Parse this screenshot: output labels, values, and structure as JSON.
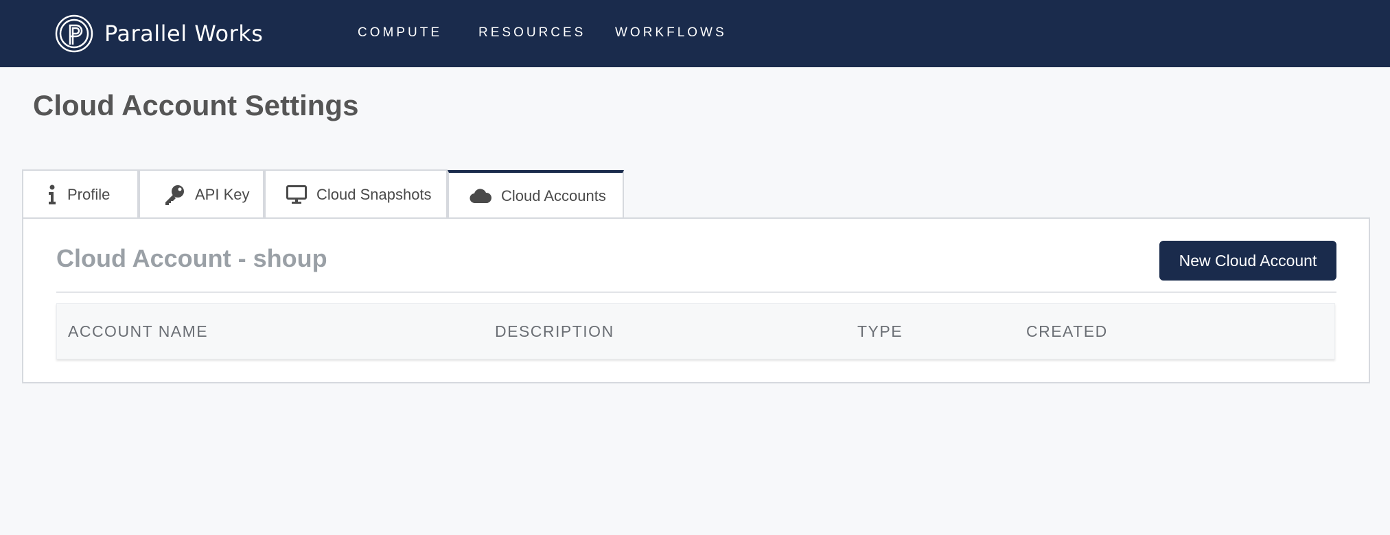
{
  "app": {
    "logo_text": "Parallel Works"
  },
  "nav": {
    "items": [
      {
        "label": "COMPUTE"
      },
      {
        "label": "RESOURCES"
      },
      {
        "label": "WORKFLOWS"
      }
    ]
  },
  "page": {
    "title": "Cloud Account Settings"
  },
  "tabs": [
    {
      "label": "Profile",
      "icon": "info-icon"
    },
    {
      "label": "API Key",
      "icon": "key-icon"
    },
    {
      "label": "Cloud Snapshots",
      "icon": "monitor-icon"
    },
    {
      "label": "Cloud Accounts",
      "icon": "cloud-icon",
      "active": true
    }
  ],
  "panel": {
    "title": "Cloud Account - shoup",
    "new_button_label": "New Cloud Account"
  },
  "table": {
    "columns": [
      "ACCOUNT NAME",
      "DESCRIPTION",
      "TYPE",
      "CREATED"
    ],
    "rows": []
  },
  "colors": {
    "brand_navy": "#1a2b4c",
    "background": "#f7f8fa"
  }
}
